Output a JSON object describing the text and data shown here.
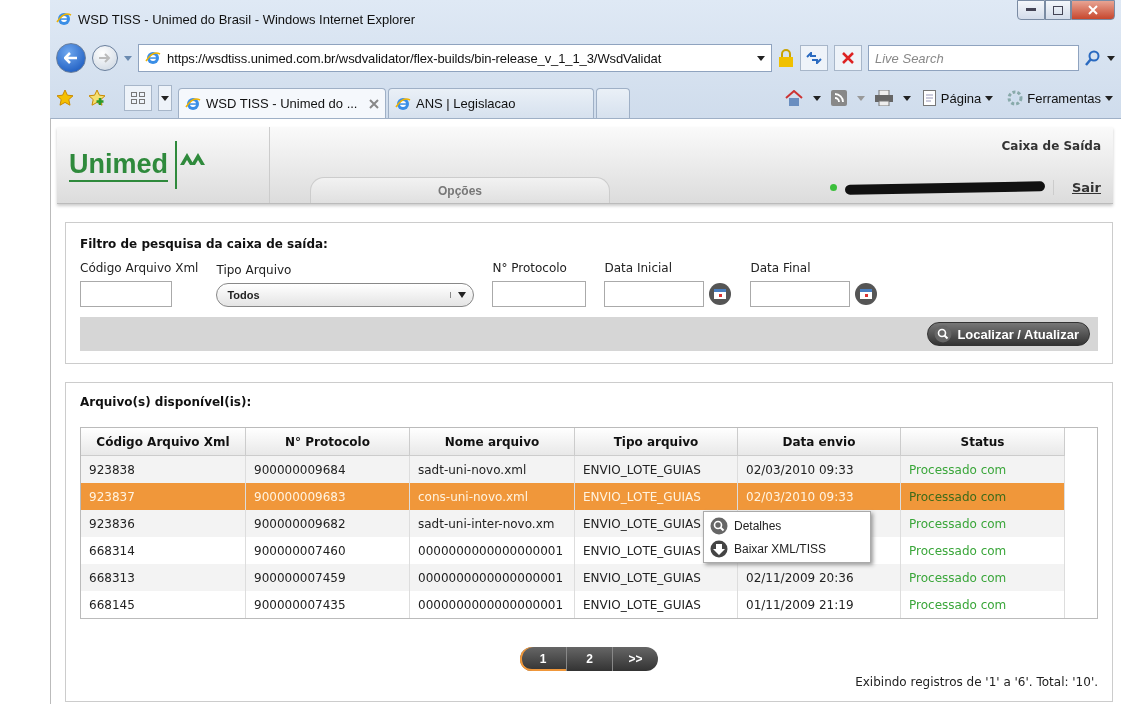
{
  "window": {
    "title": "WSD TISS - Unimed do Brasil - Windows Internet Explorer"
  },
  "address_bar": {
    "url": "https://wsdtiss.unimed.com.br/wsdvalidator/flex-builds/bin-release_v_1_1_3/WsdValidat"
  },
  "search": {
    "placeholder": "Live Search"
  },
  "browser_tabs": [
    {
      "label": "WSD TISS - Unimed do ...",
      "selected": true
    },
    {
      "label": "ANS | Legislacao",
      "selected": false
    }
  ],
  "command_bar": [
    "Página",
    "Ferramentas"
  ],
  "app": {
    "logo": "Unimed",
    "header_title": "Caixa de Saída",
    "menu_tab": "Opções",
    "logout": "Sair"
  },
  "filter": {
    "title": "Filtro de pesquisa da caixa de saída:",
    "button": "Localizar / Atualizar",
    "fields": [
      {
        "kind": "text",
        "label": "Código Arquivo Xml"
      },
      {
        "kind": "select",
        "label": "Tipo Arquivo",
        "value": "Todos"
      },
      {
        "kind": "text",
        "label": "N° Protocolo"
      },
      {
        "kind": "date",
        "label": "Data Inicial"
      },
      {
        "kind": "date",
        "label": "Data Final"
      }
    ]
  },
  "results": {
    "title": "Arquivo(s) disponível(is):",
    "columns": [
      "Código Arquivo Xml",
      "N° Protocolo",
      "Nome arquivo",
      "Tipo arquivo",
      "Data envio",
      "Status"
    ],
    "rows": [
      {
        "selected": false,
        "cells": [
          "923838",
          "900000009684",
          "sadt-uni-novo.xml",
          "ENVIO_LOTE_GUIAS",
          "02/03/2010 09:33",
          "Processado com"
        ]
      },
      {
        "selected": true,
        "cells": [
          "923837",
          "900000009683",
          "cons-uni-novo.xml",
          "ENVIO_LOTE_GUIAS",
          "02/03/2010 09:33",
          "Processado com"
        ]
      },
      {
        "selected": false,
        "cells": [
          "923836",
          "900000009682",
          "sadt-uni-inter-novo.xm",
          "ENVIO_LOTE_GUIAS",
          "",
          "Processado com"
        ]
      },
      {
        "selected": false,
        "cells": [
          "668314",
          "900000007460",
          "0000000000000000001",
          "ENVIO_LOTE_GUIAS",
          "",
          "Processado com"
        ]
      },
      {
        "selected": false,
        "cells": [
          "668313",
          "900000007459",
          "0000000000000000001",
          "ENVIO_LOTE_GUIAS",
          "02/11/2009 20:36",
          "Processado com"
        ]
      },
      {
        "selected": false,
        "cells": [
          "668145",
          "900000007435",
          "0000000000000000001",
          "ENVIO_LOTE_GUIAS",
          "01/11/2009 21:19",
          "Processado com"
        ]
      }
    ],
    "context_menu": [
      {
        "kind": "details",
        "label": "Detalhes"
      },
      {
        "kind": "download",
        "label": "Baixar XML/TISS"
      }
    ],
    "pages": [
      {
        "label": "1",
        "selected": true
      },
      {
        "label": "2",
        "selected": false
      },
      {
        "label": ">>",
        "selected": false
      }
    ],
    "summary": "Exibindo registros de '1' a '6'. Total: '10'."
  }
}
